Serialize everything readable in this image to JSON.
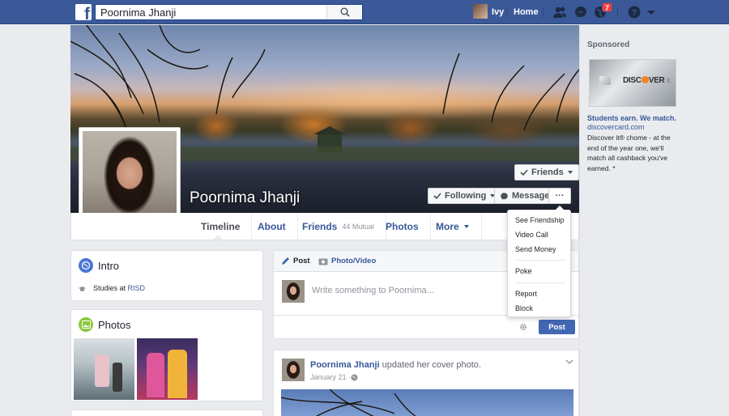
{
  "topbar": {
    "search_value": "Poornima Jhanji",
    "user_name": "Ivy",
    "home_label": "Home",
    "notification_count": "7"
  },
  "profile": {
    "name": "Poornima Jhanji",
    "friends_button": "Friends",
    "following_button": "Following",
    "message_button": "Message",
    "more_button": "···"
  },
  "tabs": {
    "timeline": "Timeline",
    "about": "About",
    "friends": "Friends",
    "mutual": "44 Mutual",
    "photos": "Photos",
    "more": "More"
  },
  "dropdown": {
    "items": [
      "See Friendship",
      "Video Call",
      "Send Money",
      "Poke",
      "Report",
      "Block"
    ]
  },
  "intro": {
    "title": "Intro",
    "studies_prefix": "Studies at",
    "school": "RISD"
  },
  "photos": {
    "title": "Photos"
  },
  "composer": {
    "post_tab": "Post",
    "photo_tab": "Photo/Video",
    "placeholder": "Write something to Poornima...",
    "post_button": "Post"
  },
  "feed": {
    "author": "Poornima Jhanji",
    "action": "updated her cover photo.",
    "date": "January 21 · "
  },
  "sidebar": {
    "sponsored": "Sponsored",
    "ad_brand": "DISC",
    "ad_brand_end": "VER",
    "ad_brand_tag": "it",
    "ad_headline": "Students earn. We match.",
    "ad_url": "discovercard.com",
    "ad_body": "Discover it® chome - at the end of the year one, we'll match all cashback you've earned. *"
  }
}
